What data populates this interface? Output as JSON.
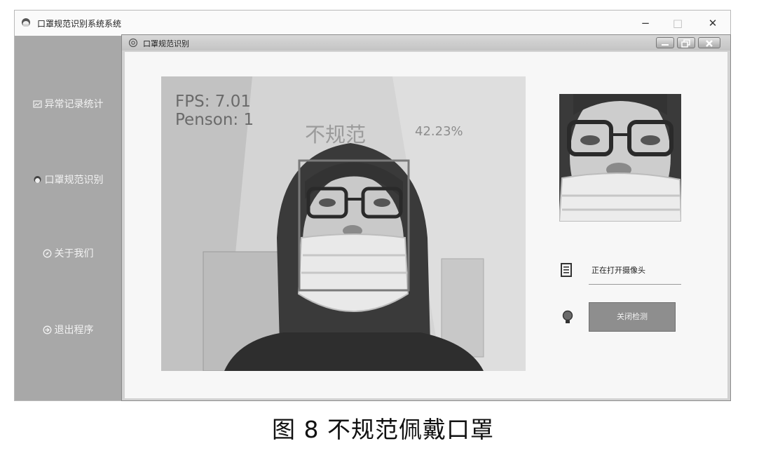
{
  "window": {
    "title": "口罩规范识别系统系统",
    "controls": {
      "minimize": "−",
      "maximize": "□",
      "close": "✕"
    }
  },
  "sidebar": {
    "items": [
      {
        "label": "异常记录统计",
        "icon": "chart-icon"
      },
      {
        "label": "口罩规范识别",
        "icon": "user-avatar-icon"
      },
      {
        "label": "关于我们",
        "icon": "compass-icon"
      },
      {
        "label": "退出程序",
        "icon": "exit-icon"
      }
    ]
  },
  "subwindow": {
    "title": "口罩规范识别"
  },
  "video": {
    "fps_text": "FPS: 7.01",
    "person_text": "Penson: 1",
    "detection_label": "不规范",
    "detection_confidence": "42.23%"
  },
  "controls": {
    "status_text": "正在打开摄像头",
    "detect_button_label": "关闭检测"
  },
  "caption": "图 8   不规范佩戴口罩"
}
